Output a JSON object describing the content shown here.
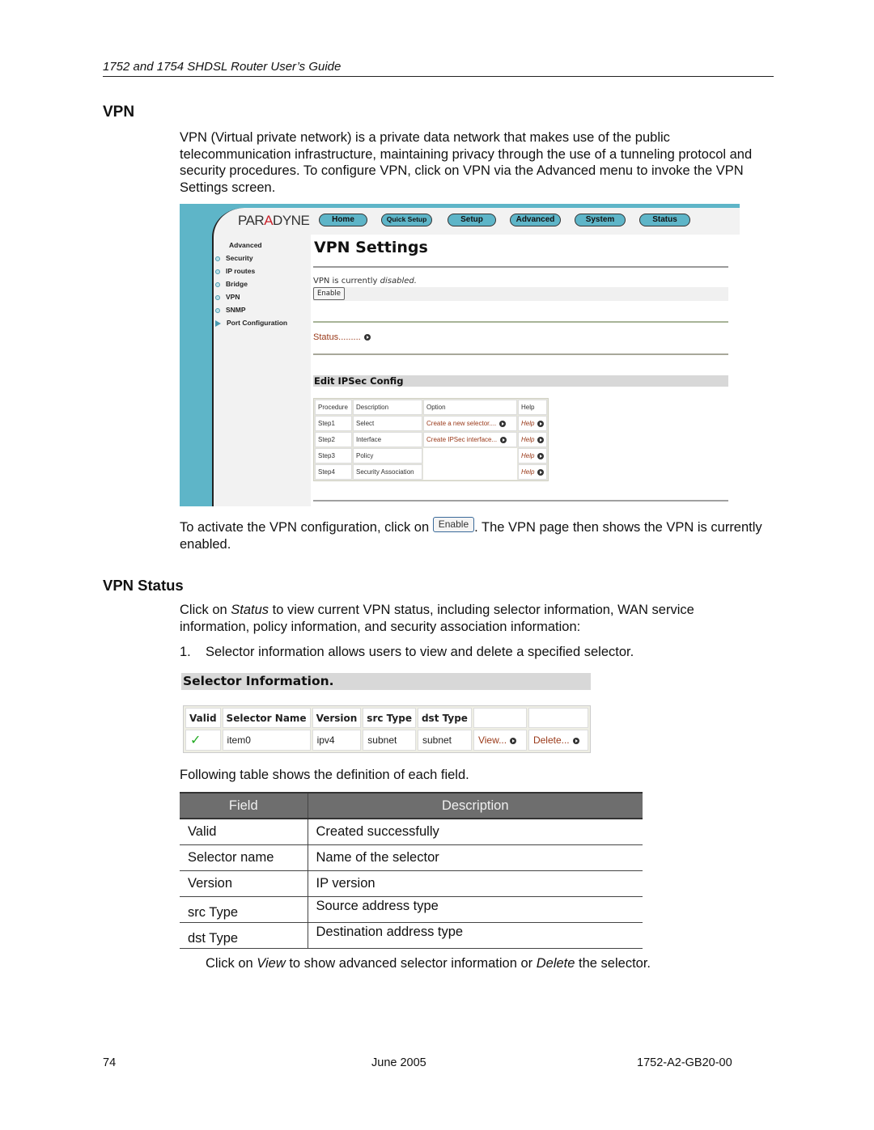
{
  "header": {
    "running_title": "1752 and 1754 SHDSL Router User’s Guide"
  },
  "section_vpn": {
    "heading": "VPN",
    "intro": "VPN (Virtual private network) is a private data network that makes use of the public telecommunication infrastructure, maintaining privacy through the use of a tunneling protocol and security procedures. To configure VPN, click on VPN via the Advanced menu to invoke the VPN Settings screen."
  },
  "screenshot_vpn_settings": {
    "logo": {
      "pre": "PAR",
      "mid": "A",
      "post": "DYNE"
    },
    "nav": [
      "Home",
      "Quick Setup",
      "Setup",
      "Advanced",
      "System",
      "Status"
    ],
    "sidebar": {
      "title": "Advanced",
      "items": [
        "Security",
        "IP routes",
        "Bridge",
        "VPN",
        "SNMP",
        "Port Configuration"
      ]
    },
    "page_title": "VPN Settings",
    "state_prefix": "VPN is currently ",
    "state_value": "disabled.",
    "enable_button": "Enable",
    "status_link": "Status.........",
    "ipsec_heading": "Edit IPSec Config",
    "ipsec_table": {
      "headers": [
        "Procedure",
        "Description",
        "Option",
        "Help"
      ],
      "rows": [
        {
          "procedure": "Step1",
          "description": "Select",
          "option": "Create a new selector....",
          "help": "Help"
        },
        {
          "procedure": "Step2",
          "description": "Interface",
          "option": "Create IPSec interface...",
          "help": "Help"
        },
        {
          "procedure": "Step3",
          "description": "Policy",
          "option": "",
          "help": "Help"
        },
        {
          "procedure": "Step4",
          "description": "Security Association",
          "option": "",
          "help": "Help"
        }
      ]
    },
    "colors": {
      "accent": "#5eb5c8",
      "link": "#9a3a1a"
    }
  },
  "activate_para": {
    "before": "To activate the VPN configuration, click on ",
    "button": "Enable",
    "after": ". The VPN page then shows the VPN is currently enabled."
  },
  "section_status": {
    "heading": "VPN Status",
    "intro_pre": "Click on ",
    "intro_em": "Status",
    "intro_post": " to view current VPN status, including selector information, WAN service information, policy information, and security association information:",
    "list_num": "1.",
    "list_text": "Selector information allows users to view and delete a specified selector."
  },
  "screenshot_selector": {
    "heading": "Selector Information.",
    "headers": [
      "Valid",
      "Selector Name",
      "Version",
      "src Type",
      "dst Type",
      "",
      ""
    ],
    "row": {
      "valid": "✓",
      "name": "item0",
      "version": "ipv4",
      "src": "subnet",
      "dst": "subnet",
      "view": "View...",
      "delete": "Delete..."
    }
  },
  "fields_intro": "Following table shows the definition of each field.",
  "fields_table": {
    "headers": [
      "Field",
      "Description"
    ],
    "rows": [
      {
        "field": "Valid",
        "description": "Created successfully"
      },
      {
        "field": "Selector name",
        "description": "Name of the selector"
      },
      {
        "field": "Version",
        "description": "IP version"
      },
      {
        "field": "src Type",
        "description": "Source address type"
      },
      {
        "field": "dst Type",
        "description": "Destination address type"
      }
    ]
  },
  "closing": {
    "pre": "Click on ",
    "em1": "View",
    "mid": " to show advanced selector information or ",
    "em2": "Delete",
    "post": " the selector."
  },
  "footer": {
    "page": "74",
    "date": "June 2005",
    "doc_id": "1752-A2-GB20-00"
  }
}
